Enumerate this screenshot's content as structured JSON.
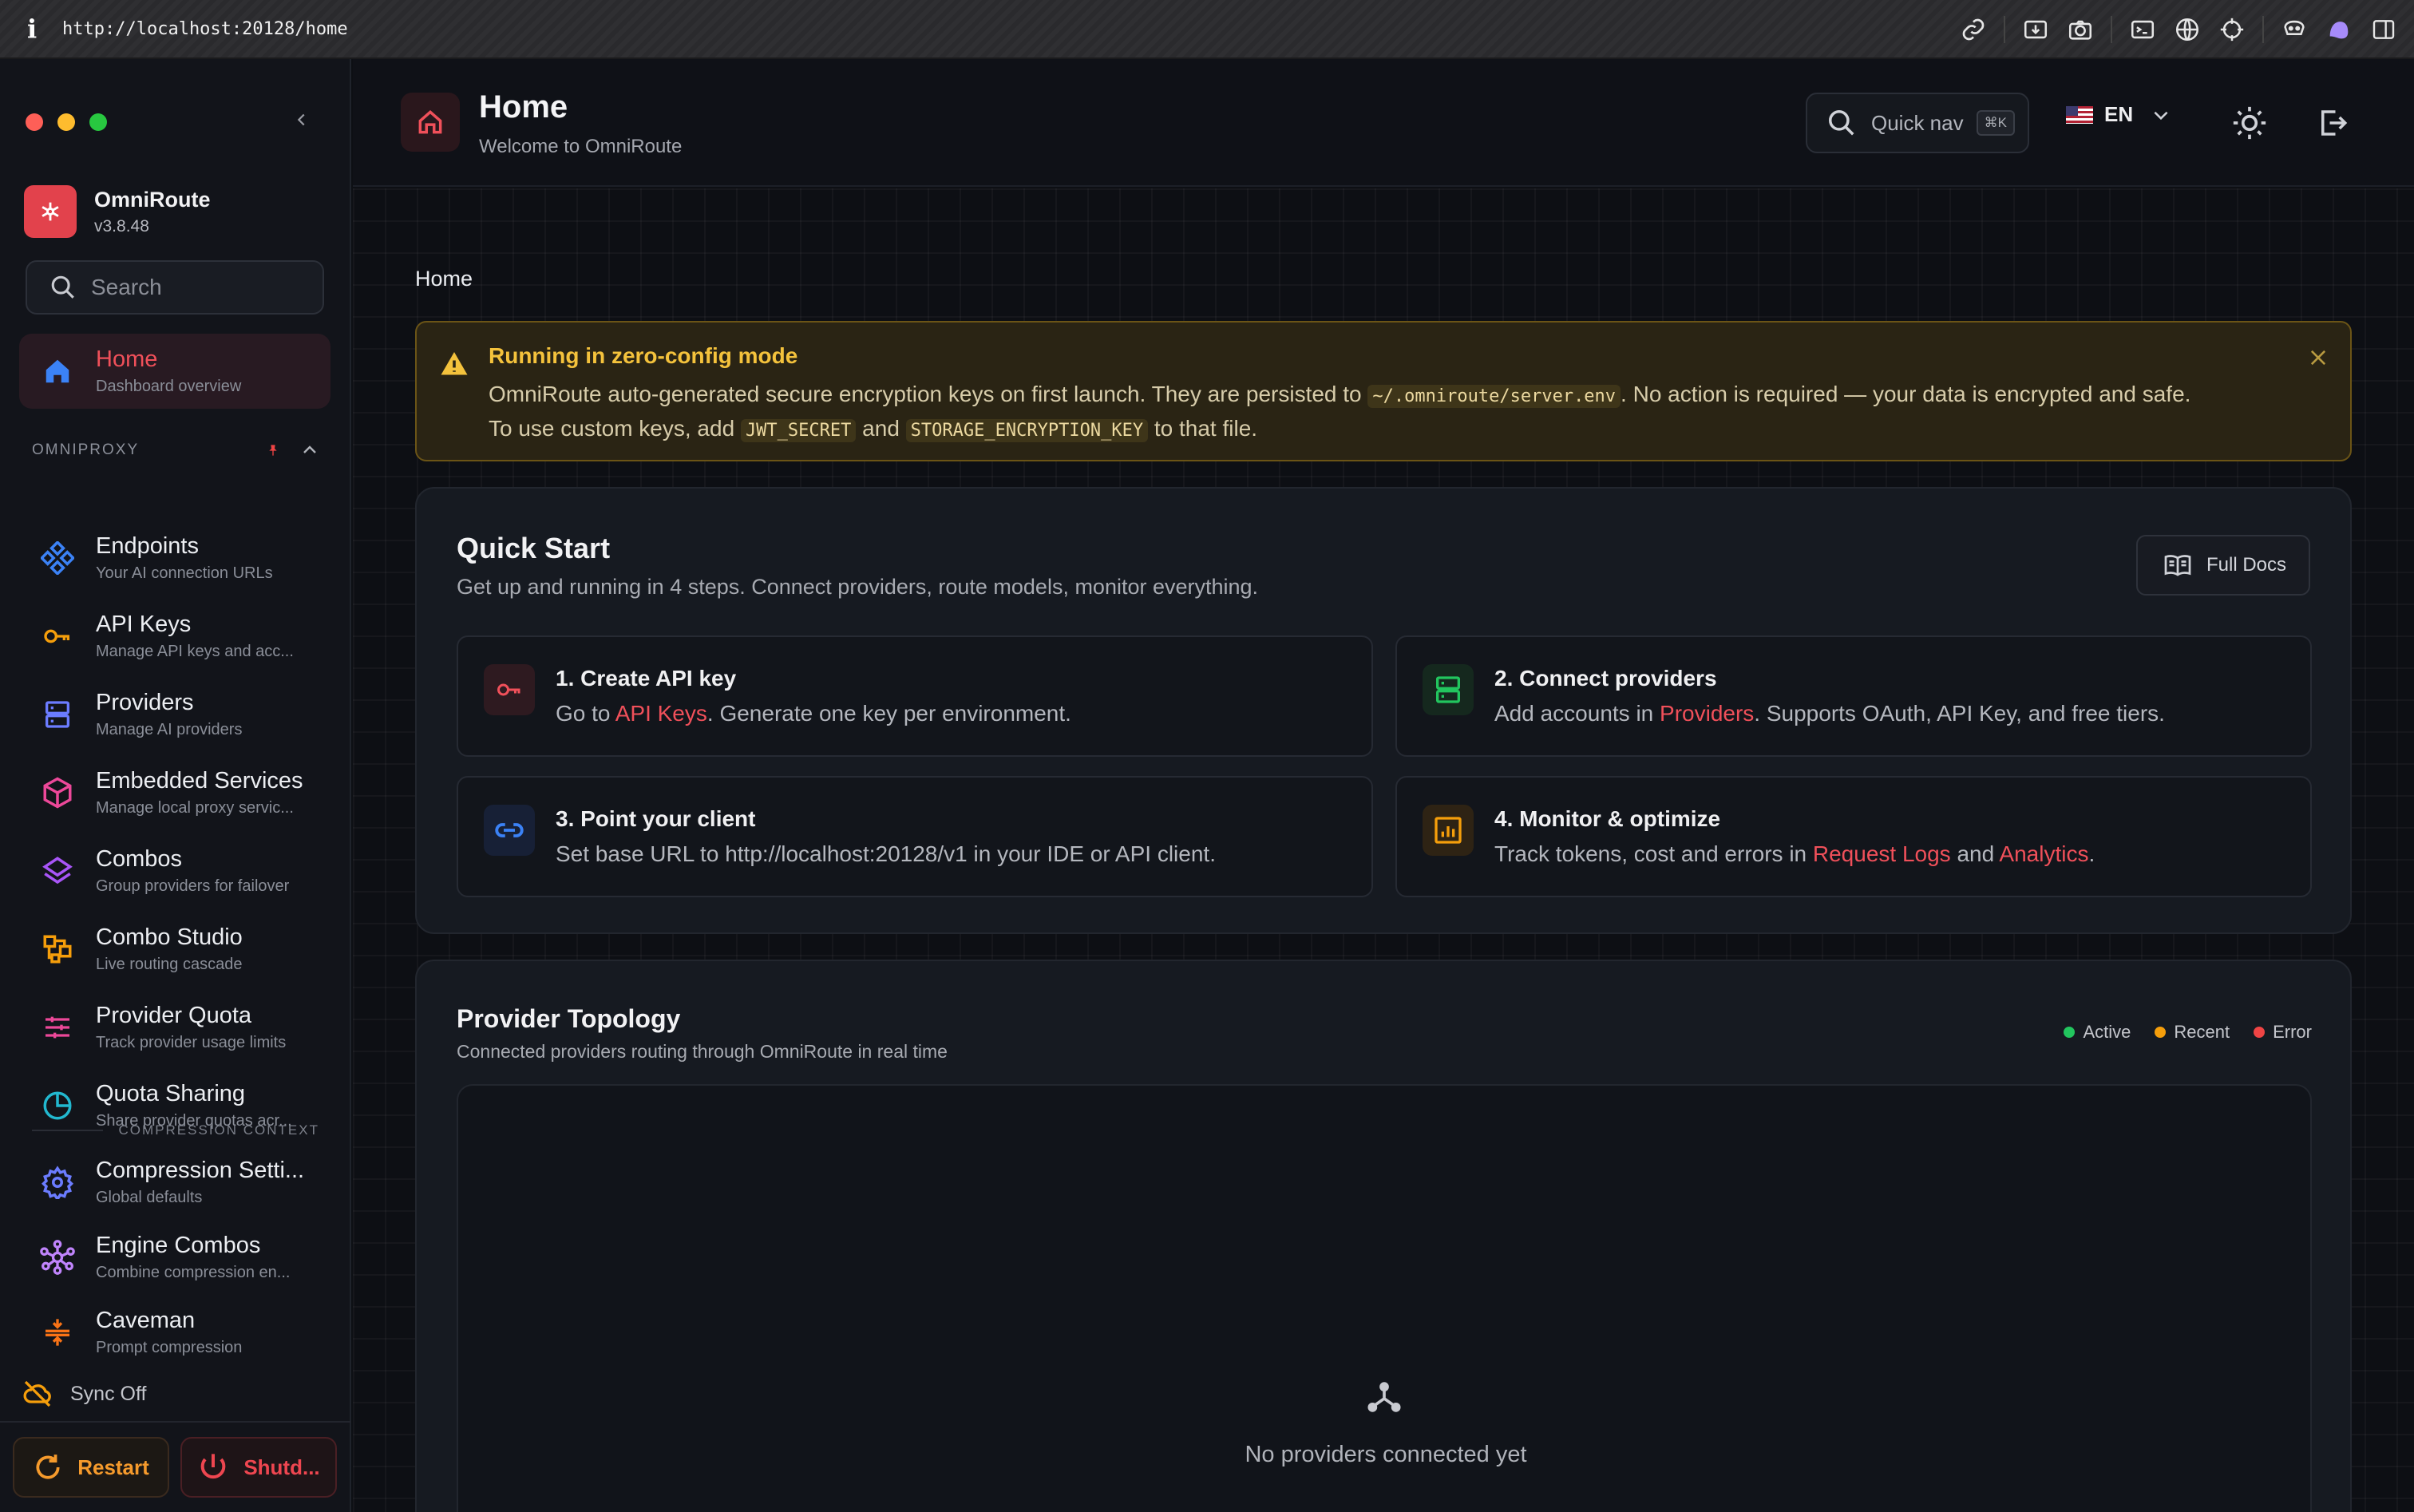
{
  "browser": {
    "url": "http://localhost:20128/home"
  },
  "sidebar": {
    "app_name": "OmniRoute",
    "version": "v3.8.48",
    "search_placeholder": "Search",
    "home": {
      "label": "Home",
      "sub": "Dashboard overview"
    },
    "group_label": "OMNIPROXY",
    "items": [
      {
        "label": "Endpoints",
        "sub": "Your AI connection URLs",
        "icon": "endpoints-icon"
      },
      {
        "label": "API Keys",
        "sub": "Manage API keys and acc...",
        "icon": "key-icon"
      },
      {
        "label": "Providers",
        "sub": "Manage AI providers",
        "icon": "server-icon"
      },
      {
        "label": "Embedded Services",
        "sub": "Manage local proxy servic...",
        "icon": "cube-icon"
      },
      {
        "label": "Combos",
        "sub": "Group providers for failover",
        "icon": "layers-icon"
      },
      {
        "label": "Combo Studio",
        "sub": "Live routing cascade",
        "icon": "workflow-icon"
      },
      {
        "label": "Provider Quota",
        "sub": "Track provider usage limits",
        "icon": "sliders-icon"
      },
      {
        "label": "Quota Sharing",
        "sub": "Share provider quotas acr...",
        "icon": "pie-icon"
      }
    ],
    "compression_label": "COMPRESSION CONTEXT",
    "compression_items": [
      {
        "label": "Compression Setti...",
        "sub": "Global defaults",
        "icon": "cog-icon"
      },
      {
        "label": "Engine Combos",
        "sub": "Combine compression en...",
        "icon": "nodes-icon"
      },
      {
        "label": "Caveman",
        "sub": "Prompt compression",
        "icon": "compress-icon"
      }
    ],
    "sync_label": "Sync Off",
    "restart_label": "Restart",
    "shutdown_label": "Shutd..."
  },
  "header": {
    "title": "Home",
    "subtitle": "Welcome to OmniRoute",
    "quicknav_label": "Quick nav",
    "quicknav_shortcut": "⌘K",
    "language": "EN"
  },
  "main": {
    "breadcrumb": "Home",
    "alert": {
      "title": "Running in zero-config mode",
      "line1_a": "OmniRoute auto-generated secure encryption keys on first launch. They are persisted to ",
      "line1_code": "~/.omniroute/server.env",
      "line1_b": ". No action is required — your data is encrypted and safe.",
      "line2_a": "To use custom keys, add ",
      "line2_code1": "JWT_SECRET",
      "line2_b": " and ",
      "line2_code2": "STORAGE_ENCRYPTION_KEY",
      "line2_c": " to that file."
    },
    "quickstart": {
      "title": "Quick Start",
      "subtitle": "Get up and running in 4 steps. Connect providers, route models, monitor everything.",
      "docs_label": "Full Docs",
      "steps": [
        {
          "title": "1. Create API key",
          "pre": "Go to ",
          "link": "API Keys",
          "post": ". Generate one key per environment."
        },
        {
          "title": "2. Connect providers",
          "pre": "Add accounts in ",
          "link": "Providers",
          "post": ". Supports OAuth, API Key, and free tiers."
        },
        {
          "title": "3. Point your client",
          "text": "Set base URL to http://localhost:20128/v1 in your IDE or API client."
        },
        {
          "title": "4. Monitor & optimize",
          "pre": "Track tokens, cost and errors in ",
          "link": "Request Logs",
          "mid": " and ",
          "link2": "Analytics",
          "post": "."
        }
      ]
    },
    "topology": {
      "title": "Provider Topology",
      "subtitle": "Connected providers routing through OmniRoute in real time",
      "legend": [
        {
          "label": "Active",
          "color": "#22c55e"
        },
        {
          "label": "Recent",
          "color": "#f59e0b"
        },
        {
          "label": "Error",
          "color": "#ef4444"
        }
      ],
      "empty_text": "No providers connected yet"
    }
  }
}
